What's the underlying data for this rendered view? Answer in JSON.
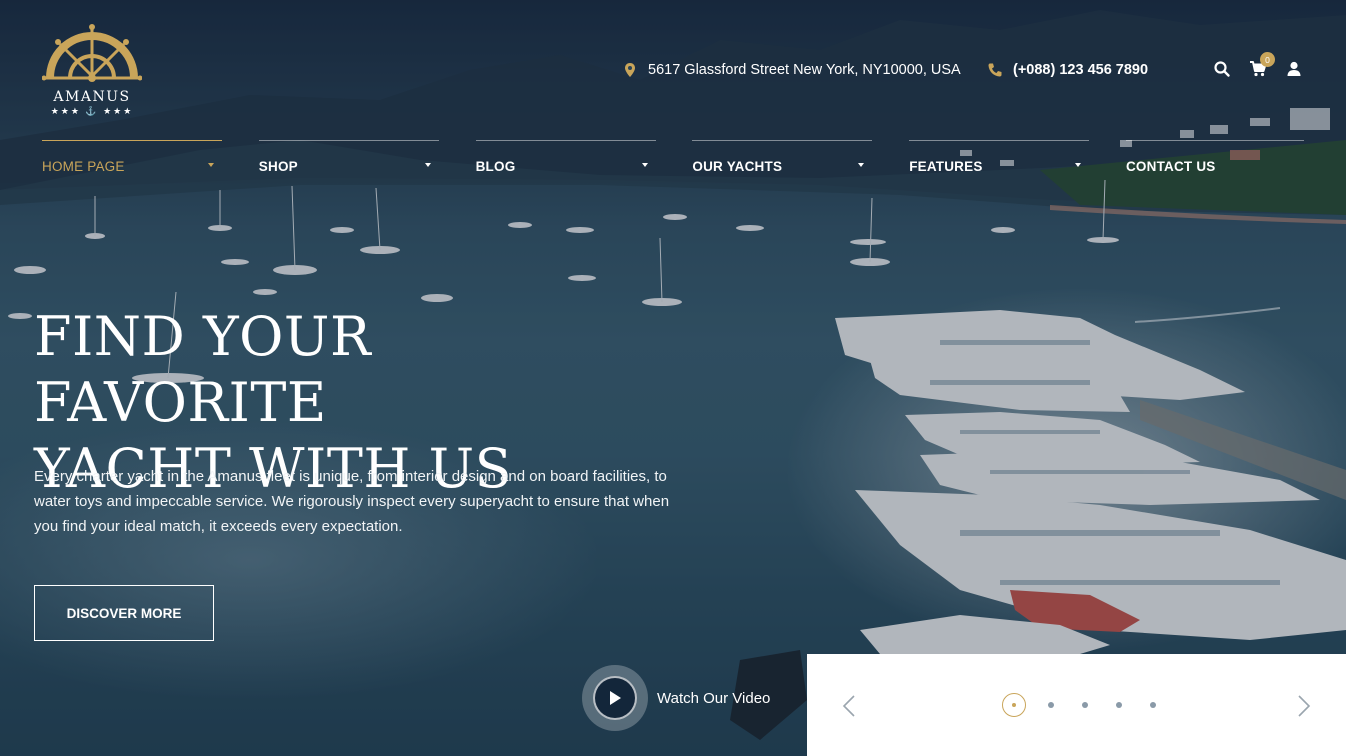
{
  "brand": {
    "name": "AMANUS",
    "stars": "★★★ ⚓ ★★★"
  },
  "header": {
    "address": "5617 Glassford Street New York, NY10000, USA",
    "phone": "(+088) 123 456 7890",
    "cart_count": "0"
  },
  "nav": {
    "items": [
      {
        "label": "HOME PAGE",
        "active": true,
        "has_dropdown": true
      },
      {
        "label": "SHOP",
        "active": false,
        "has_dropdown": true
      },
      {
        "label": "BLOG",
        "active": false,
        "has_dropdown": true
      },
      {
        "label": "OUR YACHTS",
        "active": false,
        "has_dropdown": true
      },
      {
        "label": "FEATURES",
        "active": false,
        "has_dropdown": true
      },
      {
        "label": "CONTACT US",
        "active": false,
        "has_dropdown": false
      }
    ]
  },
  "hero": {
    "headline_line1": "FIND YOUR FAVORITE",
    "headline_line2": "YACHT WITH US",
    "description": "Every charter yacht in the Amanus fleet is unique, from interior design and on board facilities, to water toys and impeccable service. We rigorously inspect every superyacht to ensure that when you find your ideal match, it exceeds every expectation.",
    "cta_label": "DISCOVER MORE",
    "video_label": "Watch Our Video"
  },
  "slider": {
    "slide_count": 5,
    "active_slide": 1
  },
  "colors": {
    "accent": "#c9a55a",
    "dark": "#13263a",
    "dot": "#8a9aa8"
  },
  "icons": [
    "ship-wheel-icon",
    "location-pin-icon",
    "phone-icon",
    "search-icon",
    "cart-icon",
    "user-icon",
    "play-icon",
    "chevron-left-icon",
    "chevron-right-icon"
  ]
}
